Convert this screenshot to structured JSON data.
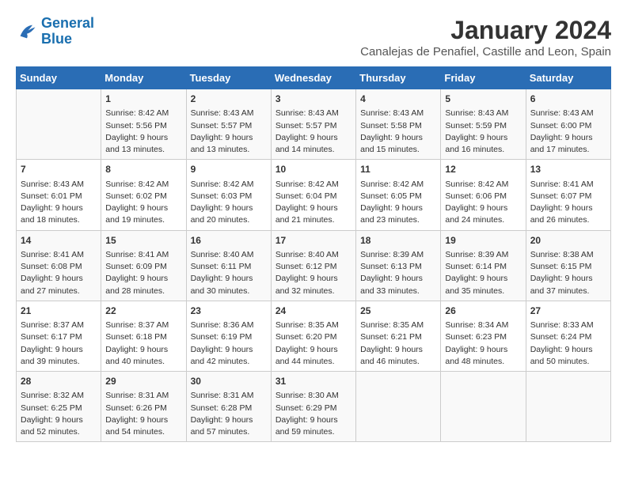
{
  "header": {
    "logo_line1": "General",
    "logo_line2": "Blue",
    "month": "January 2024",
    "location": "Canalejas de Penafiel, Castille and Leon, Spain"
  },
  "days_of_week": [
    "Sunday",
    "Monday",
    "Tuesday",
    "Wednesday",
    "Thursday",
    "Friday",
    "Saturday"
  ],
  "weeks": [
    [
      {
        "day": "",
        "empty": true
      },
      {
        "day": "1",
        "sunrise": "Sunrise: 8:42 AM",
        "sunset": "Sunset: 5:56 PM",
        "daylight": "Daylight: 9 hours and 13 minutes."
      },
      {
        "day": "2",
        "sunrise": "Sunrise: 8:43 AM",
        "sunset": "Sunset: 5:57 PM",
        "daylight": "Daylight: 9 hours and 13 minutes."
      },
      {
        "day": "3",
        "sunrise": "Sunrise: 8:43 AM",
        "sunset": "Sunset: 5:57 PM",
        "daylight": "Daylight: 9 hours and 14 minutes."
      },
      {
        "day": "4",
        "sunrise": "Sunrise: 8:43 AM",
        "sunset": "Sunset: 5:58 PM",
        "daylight": "Daylight: 9 hours and 15 minutes."
      },
      {
        "day": "5",
        "sunrise": "Sunrise: 8:43 AM",
        "sunset": "Sunset: 5:59 PM",
        "daylight": "Daylight: 9 hours and 16 minutes."
      },
      {
        "day": "6",
        "sunrise": "Sunrise: 8:43 AM",
        "sunset": "Sunset: 6:00 PM",
        "daylight": "Daylight: 9 hours and 17 minutes."
      }
    ],
    [
      {
        "day": "7",
        "sunrise": "Sunrise: 8:43 AM",
        "sunset": "Sunset: 6:01 PM",
        "daylight": "Daylight: 9 hours and 18 minutes."
      },
      {
        "day": "8",
        "sunrise": "Sunrise: 8:42 AM",
        "sunset": "Sunset: 6:02 PM",
        "daylight": "Daylight: 9 hours and 19 minutes."
      },
      {
        "day": "9",
        "sunrise": "Sunrise: 8:42 AM",
        "sunset": "Sunset: 6:03 PM",
        "daylight": "Daylight: 9 hours and 20 minutes."
      },
      {
        "day": "10",
        "sunrise": "Sunrise: 8:42 AM",
        "sunset": "Sunset: 6:04 PM",
        "daylight": "Daylight: 9 hours and 21 minutes."
      },
      {
        "day": "11",
        "sunrise": "Sunrise: 8:42 AM",
        "sunset": "Sunset: 6:05 PM",
        "daylight": "Daylight: 9 hours and 23 minutes."
      },
      {
        "day": "12",
        "sunrise": "Sunrise: 8:42 AM",
        "sunset": "Sunset: 6:06 PM",
        "daylight": "Daylight: 9 hours and 24 minutes."
      },
      {
        "day": "13",
        "sunrise": "Sunrise: 8:41 AM",
        "sunset": "Sunset: 6:07 PM",
        "daylight": "Daylight: 9 hours and 26 minutes."
      }
    ],
    [
      {
        "day": "14",
        "sunrise": "Sunrise: 8:41 AM",
        "sunset": "Sunset: 6:08 PM",
        "daylight": "Daylight: 9 hours and 27 minutes."
      },
      {
        "day": "15",
        "sunrise": "Sunrise: 8:41 AM",
        "sunset": "Sunset: 6:09 PM",
        "daylight": "Daylight: 9 hours and 28 minutes."
      },
      {
        "day": "16",
        "sunrise": "Sunrise: 8:40 AM",
        "sunset": "Sunset: 6:11 PM",
        "daylight": "Daylight: 9 hours and 30 minutes."
      },
      {
        "day": "17",
        "sunrise": "Sunrise: 8:40 AM",
        "sunset": "Sunset: 6:12 PM",
        "daylight": "Daylight: 9 hours and 32 minutes."
      },
      {
        "day": "18",
        "sunrise": "Sunrise: 8:39 AM",
        "sunset": "Sunset: 6:13 PM",
        "daylight": "Daylight: 9 hours and 33 minutes."
      },
      {
        "day": "19",
        "sunrise": "Sunrise: 8:39 AM",
        "sunset": "Sunset: 6:14 PM",
        "daylight": "Daylight: 9 hours and 35 minutes."
      },
      {
        "day": "20",
        "sunrise": "Sunrise: 8:38 AM",
        "sunset": "Sunset: 6:15 PM",
        "daylight": "Daylight: 9 hours and 37 minutes."
      }
    ],
    [
      {
        "day": "21",
        "sunrise": "Sunrise: 8:37 AM",
        "sunset": "Sunset: 6:17 PM",
        "daylight": "Daylight: 9 hours and 39 minutes."
      },
      {
        "day": "22",
        "sunrise": "Sunrise: 8:37 AM",
        "sunset": "Sunset: 6:18 PM",
        "daylight": "Daylight: 9 hours and 40 minutes."
      },
      {
        "day": "23",
        "sunrise": "Sunrise: 8:36 AM",
        "sunset": "Sunset: 6:19 PM",
        "daylight": "Daylight: 9 hours and 42 minutes."
      },
      {
        "day": "24",
        "sunrise": "Sunrise: 8:35 AM",
        "sunset": "Sunset: 6:20 PM",
        "daylight": "Daylight: 9 hours and 44 minutes."
      },
      {
        "day": "25",
        "sunrise": "Sunrise: 8:35 AM",
        "sunset": "Sunset: 6:21 PM",
        "daylight": "Daylight: 9 hours and 46 minutes."
      },
      {
        "day": "26",
        "sunrise": "Sunrise: 8:34 AM",
        "sunset": "Sunset: 6:23 PM",
        "daylight": "Daylight: 9 hours and 48 minutes."
      },
      {
        "day": "27",
        "sunrise": "Sunrise: 8:33 AM",
        "sunset": "Sunset: 6:24 PM",
        "daylight": "Daylight: 9 hours and 50 minutes."
      }
    ],
    [
      {
        "day": "28",
        "sunrise": "Sunrise: 8:32 AM",
        "sunset": "Sunset: 6:25 PM",
        "daylight": "Daylight: 9 hours and 52 minutes."
      },
      {
        "day": "29",
        "sunrise": "Sunrise: 8:31 AM",
        "sunset": "Sunset: 6:26 PM",
        "daylight": "Daylight: 9 hours and 54 minutes."
      },
      {
        "day": "30",
        "sunrise": "Sunrise: 8:31 AM",
        "sunset": "Sunset: 6:28 PM",
        "daylight": "Daylight: 9 hours and 57 minutes."
      },
      {
        "day": "31",
        "sunrise": "Sunrise: 8:30 AM",
        "sunset": "Sunset: 6:29 PM",
        "daylight": "Daylight: 9 hours and 59 minutes."
      },
      {
        "day": "",
        "empty": true
      },
      {
        "day": "",
        "empty": true
      },
      {
        "day": "",
        "empty": true
      }
    ]
  ]
}
